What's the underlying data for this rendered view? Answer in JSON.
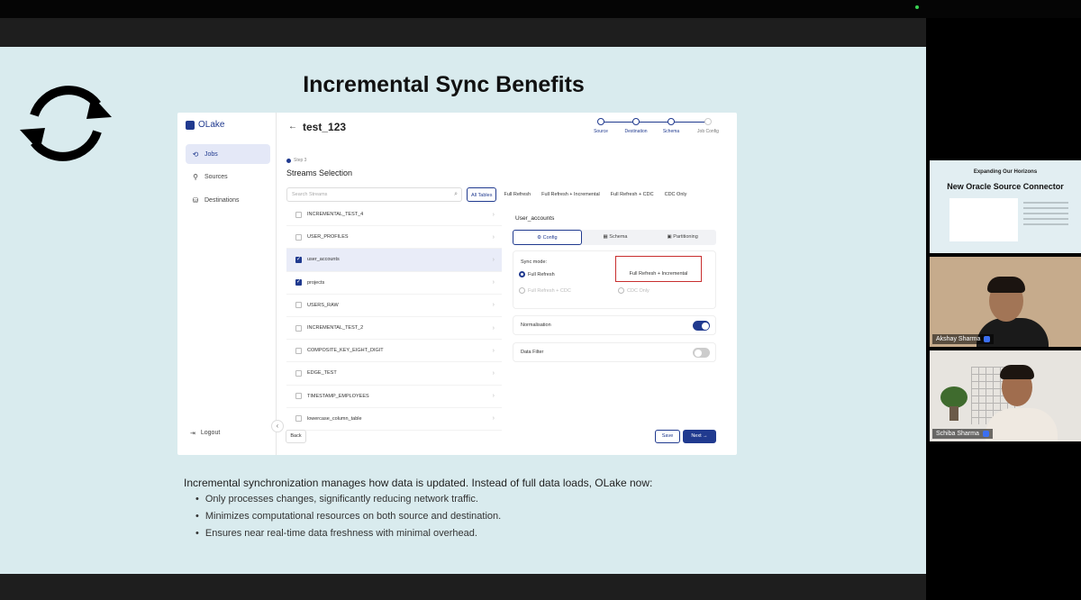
{
  "slide": {
    "title": "Incremental Sync Benefits",
    "body_intro": "Incremental synchronization manages how data is updated. Instead of full data loads, OLake now:",
    "bullets": [
      "Only processes changes, significantly reducing network traffic.",
      "Minimizes computational resources on both source and destination.",
      "Ensures near real-time data freshness with minimal overhead."
    ]
  },
  "app": {
    "brand": "OLake",
    "nav": [
      {
        "label": "Jobs",
        "icon": "jobs-icon"
      },
      {
        "label": "Sources",
        "icon": "sources-icon"
      },
      {
        "label": "Destinations",
        "icon": "destinations-icon"
      }
    ],
    "logout": "Logout",
    "job_title": "test_123",
    "steps": [
      "Source",
      "Destination",
      "Schema",
      "Job Config"
    ],
    "step_label": "Step 3",
    "section_title": "Streams Selection",
    "search_placeholder": "Search Streams",
    "filters": [
      "All Tables",
      "Full Refresh",
      "Full Refresh + Incremental",
      "Full Refresh + CDC",
      "CDC Only"
    ],
    "streams": [
      {
        "name": "INCREMENTAL_TEST_4",
        "checked": false
      },
      {
        "name": "USER_PROFILES",
        "checked": false
      },
      {
        "name": "user_accounts",
        "checked": true
      },
      {
        "name": "projects",
        "checked": true
      },
      {
        "name": "USERS_RAW",
        "checked": false
      },
      {
        "name": "INCREMENTAL_TEST_2",
        "checked": false
      },
      {
        "name": "COMPOSITE_KEY_EIGHT_DIGIT",
        "checked": false
      },
      {
        "name": "EDGE_TEST",
        "checked": false
      },
      {
        "name": "TIMESTAMP_EMPLOYEES",
        "checked": false
      },
      {
        "name": "lowercase_column_table",
        "checked": false
      }
    ],
    "panel": {
      "stream_name": "User_accounts",
      "tabs": [
        "Config",
        "Schema",
        "Partitioning"
      ],
      "sync_mode_label": "Sync mode:",
      "full_refresh": "Full Refresh",
      "full_refresh_incremental": "Full Refresh + Incremental",
      "full_refresh_cdc": "Full Refresh + CDC",
      "cdc_only": "CDC Only",
      "normalisation": "Normalisation",
      "normalisation_on": true,
      "data_filter": "Data Filter",
      "data_filter_on": false
    },
    "buttons": {
      "back": "Back",
      "save": "Save",
      "next": "Next →"
    }
  },
  "participants": {
    "slide_tile_sub": "Expanding Our Horizons",
    "slide_tile_title": "New Oracle Source Connector",
    "person1": "Akshay Sharma",
    "person2": "Schiba Sharma"
  },
  "colors": {
    "accent": "#203a8f",
    "highlight": "#c82f2f",
    "slide_bg": "#d9ebee"
  }
}
